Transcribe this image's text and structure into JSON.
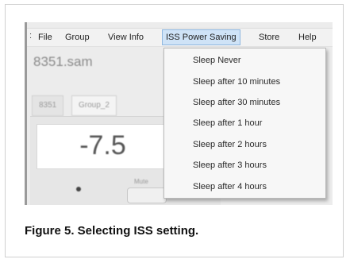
{
  "menubar": {
    "items": [
      "File",
      "Group",
      "View Info",
      "ISS Power Saving",
      "Store",
      "Help"
    ]
  },
  "document": {
    "title": "8351.sam"
  },
  "tabs": [
    "8351",
    "Group_2"
  ],
  "display": {
    "value": "-7.5",
    "mute_label": "Mute"
  },
  "dropdown": {
    "items": [
      "Sleep Never",
      "Sleep after 10 minutes",
      "Sleep after 30 minutes",
      "Sleep after 1 hour",
      "Sleep after 2 hours",
      "Sleep after 3 hours",
      "Sleep after 4 hours"
    ]
  },
  "caption": "Figure 5. Selecting ISS setting.",
  "colors": {
    "menu_highlight": "#cfe3f7",
    "menu_highlight_border": "#8fb7df"
  }
}
